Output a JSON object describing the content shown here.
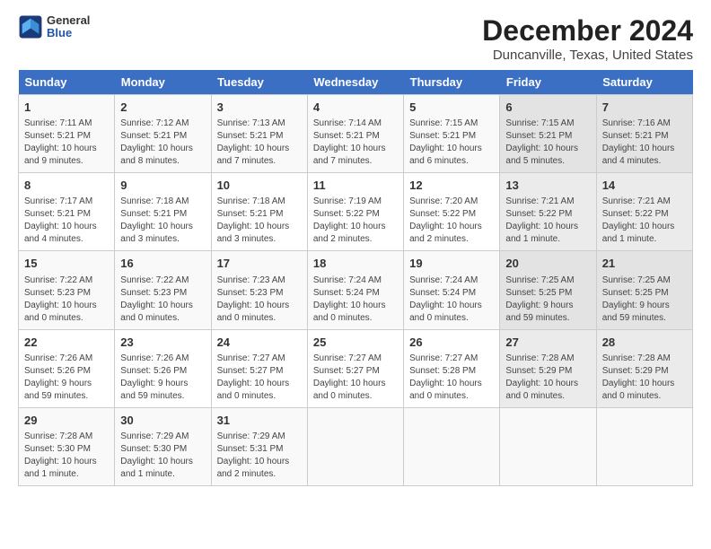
{
  "header": {
    "logo_line1": "General",
    "logo_line2": "Blue",
    "title": "December 2024",
    "subtitle": "Duncanville, Texas, United States"
  },
  "columns": [
    "Sunday",
    "Monday",
    "Tuesday",
    "Wednesday",
    "Thursday",
    "Friday",
    "Saturday"
  ],
  "weeks": [
    [
      {
        "day": "1",
        "info": "Sunrise: 7:11 AM\nSunset: 5:21 PM\nDaylight: 10 hours and 9 minutes."
      },
      {
        "day": "2",
        "info": "Sunrise: 7:12 AM\nSunset: 5:21 PM\nDaylight: 10 hours and 8 minutes."
      },
      {
        "day": "3",
        "info": "Sunrise: 7:13 AM\nSunset: 5:21 PM\nDaylight: 10 hours and 7 minutes."
      },
      {
        "day": "4",
        "info": "Sunrise: 7:14 AM\nSunset: 5:21 PM\nDaylight: 10 hours and 7 minutes."
      },
      {
        "day": "5",
        "info": "Sunrise: 7:15 AM\nSunset: 5:21 PM\nDaylight: 10 hours and 6 minutes."
      },
      {
        "day": "6",
        "info": "Sunrise: 7:15 AM\nSunset: 5:21 PM\nDaylight: 10 hours and 5 minutes."
      },
      {
        "day": "7",
        "info": "Sunrise: 7:16 AM\nSunset: 5:21 PM\nDaylight: 10 hours and 4 minutes."
      }
    ],
    [
      {
        "day": "8",
        "info": "Sunrise: 7:17 AM\nSunset: 5:21 PM\nDaylight: 10 hours and 4 minutes."
      },
      {
        "day": "9",
        "info": "Sunrise: 7:18 AM\nSunset: 5:21 PM\nDaylight: 10 hours and 3 minutes."
      },
      {
        "day": "10",
        "info": "Sunrise: 7:18 AM\nSunset: 5:21 PM\nDaylight: 10 hours and 3 minutes."
      },
      {
        "day": "11",
        "info": "Sunrise: 7:19 AM\nSunset: 5:22 PM\nDaylight: 10 hours and 2 minutes."
      },
      {
        "day": "12",
        "info": "Sunrise: 7:20 AM\nSunset: 5:22 PM\nDaylight: 10 hours and 2 minutes."
      },
      {
        "day": "13",
        "info": "Sunrise: 7:21 AM\nSunset: 5:22 PM\nDaylight: 10 hours and 1 minute."
      },
      {
        "day": "14",
        "info": "Sunrise: 7:21 AM\nSunset: 5:22 PM\nDaylight: 10 hours and 1 minute."
      }
    ],
    [
      {
        "day": "15",
        "info": "Sunrise: 7:22 AM\nSunset: 5:23 PM\nDaylight: 10 hours and 0 minutes."
      },
      {
        "day": "16",
        "info": "Sunrise: 7:22 AM\nSunset: 5:23 PM\nDaylight: 10 hours and 0 minutes."
      },
      {
        "day": "17",
        "info": "Sunrise: 7:23 AM\nSunset: 5:23 PM\nDaylight: 10 hours and 0 minutes."
      },
      {
        "day": "18",
        "info": "Sunrise: 7:24 AM\nSunset: 5:24 PM\nDaylight: 10 hours and 0 minutes."
      },
      {
        "day": "19",
        "info": "Sunrise: 7:24 AM\nSunset: 5:24 PM\nDaylight: 10 hours and 0 minutes."
      },
      {
        "day": "20",
        "info": "Sunrise: 7:25 AM\nSunset: 5:25 PM\nDaylight: 9 hours and 59 minutes."
      },
      {
        "day": "21",
        "info": "Sunrise: 7:25 AM\nSunset: 5:25 PM\nDaylight: 9 hours and 59 minutes."
      }
    ],
    [
      {
        "day": "22",
        "info": "Sunrise: 7:26 AM\nSunset: 5:26 PM\nDaylight: 9 hours and 59 minutes."
      },
      {
        "day": "23",
        "info": "Sunrise: 7:26 AM\nSunset: 5:26 PM\nDaylight: 9 hours and 59 minutes."
      },
      {
        "day": "24",
        "info": "Sunrise: 7:27 AM\nSunset: 5:27 PM\nDaylight: 10 hours and 0 minutes."
      },
      {
        "day": "25",
        "info": "Sunrise: 7:27 AM\nSunset: 5:27 PM\nDaylight: 10 hours and 0 minutes."
      },
      {
        "day": "26",
        "info": "Sunrise: 7:27 AM\nSunset: 5:28 PM\nDaylight: 10 hours and 0 minutes."
      },
      {
        "day": "27",
        "info": "Sunrise: 7:28 AM\nSunset: 5:29 PM\nDaylight: 10 hours and 0 minutes."
      },
      {
        "day": "28",
        "info": "Sunrise: 7:28 AM\nSunset: 5:29 PM\nDaylight: 10 hours and 0 minutes."
      }
    ],
    [
      {
        "day": "29",
        "info": "Sunrise: 7:28 AM\nSunset: 5:30 PM\nDaylight: 10 hours and 1 minute."
      },
      {
        "day": "30",
        "info": "Sunrise: 7:29 AM\nSunset: 5:30 PM\nDaylight: 10 hours and 1 minute."
      },
      {
        "day": "31",
        "info": "Sunrise: 7:29 AM\nSunset: 5:31 PM\nDaylight: 10 hours and 2 minutes."
      },
      {
        "day": "",
        "info": ""
      },
      {
        "day": "",
        "info": ""
      },
      {
        "day": "",
        "info": ""
      },
      {
        "day": "",
        "info": ""
      }
    ]
  ]
}
